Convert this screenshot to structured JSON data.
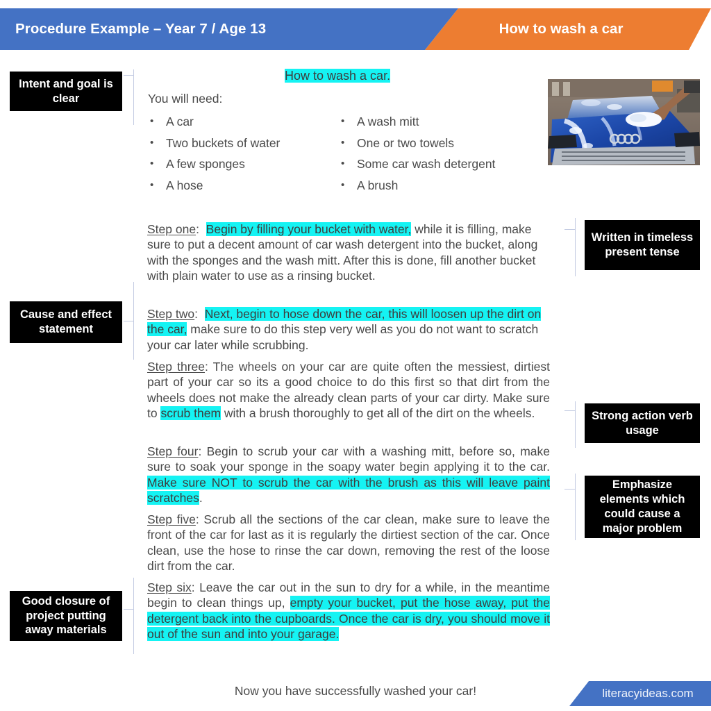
{
  "header": {
    "left_title": "Procedure Example – Year 7 / Age 13",
    "right_title": "How to wash a car",
    "blue": "#4472C4",
    "orange": "#ED7D31"
  },
  "document": {
    "title": "How to wash a car.",
    "needs_label": "You will need:",
    "materials_left": [
      "A car",
      "Two buckets of water",
      "A few sponges",
      "A hose"
    ],
    "materials_right": [
      "A wash mitt",
      "One or two towels",
      "Some car wash detergent",
      "A brush"
    ],
    "photo_alt": "blue car covered in soap suds being washed by hand with a mitt",
    "steps": [
      {
        "label": "Step one",
        "colon": ":",
        "highlight_lead": "Begin by filling your bucket with water,",
        "rest": " while it is filling, make sure to put a decent amount of car wash detergent into the bucket, along with the sponges and the wash mitt. After this is done, fill another bucket with plain water to use as a rinsing bucket."
      },
      {
        "label": "Step two",
        "colon": ":",
        "highlight_lead": "Next, begin to hose down the car, this will loosen up the dirt on the car,",
        "rest": " make sure to do this step very well as you do not want to scratch your car later while scrubbing."
      },
      {
        "label": "Step three",
        "colon": ":",
        "lead": "  The wheels on your car are quite often the messiest, dirtiest part of your car so its a good choice to do this first so that dirt from the wheels does not make the already clean parts of your car dirty. Make sure to ",
        "highlight_mid": "scrub them",
        "tail": " with a brush thoroughly to get all of the dirt on the wheels."
      },
      {
        "label": "Step four",
        "colon": ":",
        "lead": "  Begin to scrub your car with a washing mitt, before so, make sure to soak your sponge in the soapy water begin applying it to the car. ",
        "highlight_mid": "Make sure NOT to scrub the car with the brush as this will leave paint scratches",
        "tail": "."
      },
      {
        "label": "Step five",
        "colon": ":",
        "lead": "  Scrub all the sections of the car clean, make sure to leave the front of the car for last as it is regularly the dirtiest section of the car. Once clean, use the hose to rinse the car down, removing the rest of the loose dirt from the car.",
        "highlight_mid": "",
        "tail": ""
      },
      {
        "label": "Step six",
        "colon": ":",
        "lead": "  Leave the car out in the sun to dry for a while, in the meantime begin to clean things up, ",
        "highlight_mid": "empty your bucket, put the hose away, put the detergent back into the cupboards. Once the car is dry, you should move it out of the sun and into your garage.",
        "tail": ""
      }
    ],
    "closing": "Now you have successfully washed your car!"
  },
  "annotations": {
    "left": [
      {
        "text": "Intent and goal is clear"
      },
      {
        "text": "Cause and effect statement"
      },
      {
        "text": "Good closure of project putting away materials"
      }
    ],
    "right": [
      {
        "text": "Written in timeless present tense"
      },
      {
        "text": "Strong action verb usage"
      },
      {
        "text": "Emphasize elements which could cause a major problem"
      }
    ]
  },
  "footer": {
    "brand": "literacyideas.com"
  },
  "colors": {
    "highlight": "#15F3F3",
    "callout_bg": "#000000",
    "connector": "#C3CBE2",
    "text": "#4A4A4A"
  }
}
